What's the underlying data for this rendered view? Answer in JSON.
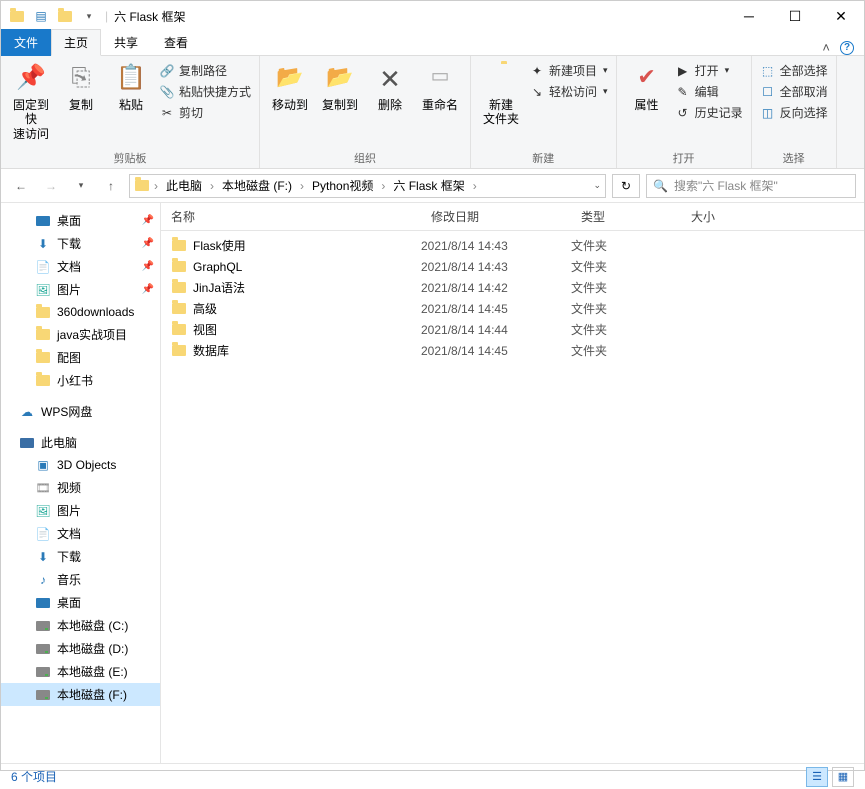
{
  "title": "六 Flask 框架",
  "tabs": {
    "file": "文件",
    "home": "主页",
    "share": "共享",
    "view": "查看"
  },
  "ribbon": {
    "groups": {
      "clipboard": {
        "label": "剪贴板",
        "pin": "固定到快\n速访问",
        "copy": "复制",
        "paste": "粘贴",
        "copy_path": "复制路径",
        "paste_shortcut": "粘贴快捷方式",
        "cut": "剪切"
      },
      "organize": {
        "label": "组织",
        "move_to": "移动到",
        "copy_to": "复制到",
        "delete": "删除",
        "rename": "重命名"
      },
      "new": {
        "label": "新建",
        "new_folder": "新建\n文件夹",
        "new_item": "新建项目",
        "easy_access": "轻松访问"
      },
      "open": {
        "label": "打开",
        "properties": "属性",
        "open": "打开",
        "edit": "编辑",
        "history": "历史记录"
      },
      "select": {
        "label": "选择",
        "select_all": "全部选择",
        "select_none": "全部取消",
        "invert": "反向选择"
      }
    }
  },
  "breadcrumb": [
    "此电脑",
    "本地磁盘 (F:)",
    "Python视频",
    "六 Flask 框架"
  ],
  "search_placeholder": "搜索\"六 Flask 框架\"",
  "navpane": {
    "quick": [
      {
        "label": "桌面",
        "icon": "desktop",
        "pin": true
      },
      {
        "label": "下载",
        "icon": "download",
        "pin": true
      },
      {
        "label": "文档",
        "icon": "doc",
        "pin": true
      },
      {
        "label": "图片",
        "icon": "pic",
        "pin": true
      },
      {
        "label": "360downloads",
        "icon": "folder"
      },
      {
        "label": "java实战项目",
        "icon": "folder"
      },
      {
        "label": "配图",
        "icon": "folder"
      },
      {
        "label": "小红书",
        "icon": "folder"
      }
    ],
    "wps": "WPS网盘",
    "thispc": "此电脑",
    "pc_items": [
      {
        "label": "3D Objects",
        "icon": "3d"
      },
      {
        "label": "视频",
        "icon": "video"
      },
      {
        "label": "图片",
        "icon": "pic"
      },
      {
        "label": "文档",
        "icon": "doc"
      },
      {
        "label": "下载",
        "icon": "download"
      },
      {
        "label": "音乐",
        "icon": "music"
      },
      {
        "label": "桌面",
        "icon": "desktop"
      },
      {
        "label": "本地磁盘 (C:)",
        "icon": "disk"
      },
      {
        "label": "本地磁盘 (D:)",
        "icon": "disk"
      },
      {
        "label": "本地磁盘 (E:)",
        "icon": "disk"
      },
      {
        "label": "本地磁盘 (F:)",
        "icon": "disk",
        "selected": true
      }
    ]
  },
  "columns": {
    "name": "名称",
    "date": "修改日期",
    "type": "类型",
    "size": "大小"
  },
  "files": [
    {
      "name": "Flask使用",
      "date": "2021/8/14 14:43",
      "type": "文件夹"
    },
    {
      "name": "GraphQL",
      "date": "2021/8/14 14:43",
      "type": "文件夹"
    },
    {
      "name": "JinJa语法",
      "date": "2021/8/14 14:42",
      "type": "文件夹"
    },
    {
      "name": "高级",
      "date": "2021/8/14 14:45",
      "type": "文件夹"
    },
    {
      "name": "视图",
      "date": "2021/8/14 14:44",
      "type": "文件夹"
    },
    {
      "name": "数据库",
      "date": "2021/8/14 14:45",
      "type": "文件夹"
    }
  ],
  "status": "6 个项目"
}
